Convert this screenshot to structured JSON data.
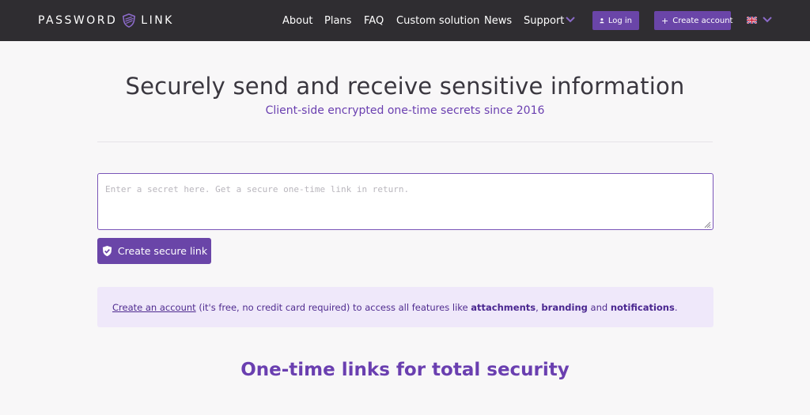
{
  "nav": {
    "brand_left": "PASSWORD",
    "brand_right": "LINK",
    "links": [
      "About",
      "Plans",
      "FAQ",
      "Custom solution",
      "News",
      "Support"
    ],
    "login_label": "Log in",
    "create_account_label": "Create account",
    "language_flag": "UK"
  },
  "hero": {
    "title": "Securely send and receive sensitive information",
    "subtitle": "Client-side encrypted one-time secrets since 2016"
  },
  "form": {
    "secret_placeholder": "Enter a secret here. Get a secure one-time link in return.",
    "submit_label": "Create secure link"
  },
  "info": {
    "link_text": "Create an account",
    "text_1": " (it's free, no credit card required) to access all features like ",
    "feature_1": "attachments",
    "sep_1": ", ",
    "feature_2": "branding",
    "sep_2": " and ",
    "feature_3": "notifications",
    "end": "."
  },
  "section": {
    "title": "One-time links for total security"
  },
  "colors": {
    "navbar": "#2f2d31",
    "accent": "#6a45a8",
    "info_bg": "#efe8fa",
    "page_bg": "#f8f7f8"
  }
}
